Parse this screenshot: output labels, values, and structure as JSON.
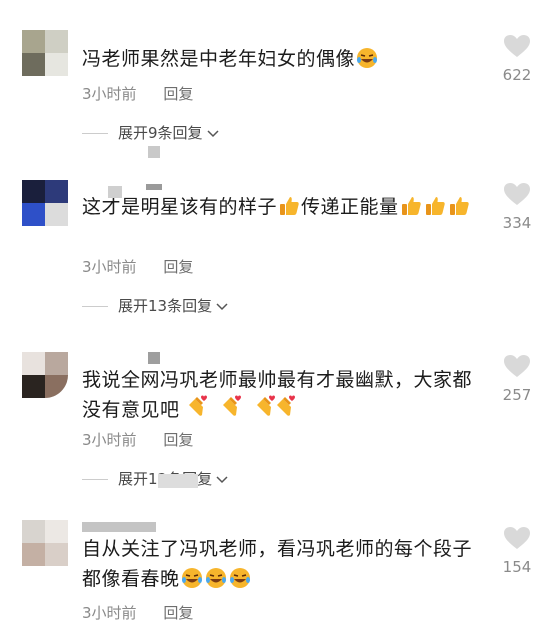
{
  "comments": [
    {
      "text_parts": [
        "冯老师果然是中老年妇女的偶像"
      ],
      "emojis": [
        "laugh"
      ],
      "time": "3小时前",
      "reply": "回复",
      "expand": "展开9条回复",
      "likes": "622"
    },
    {
      "text_part1": "这才是明星该有的样子",
      "text_part2": "传递正能量",
      "time": "3小时前",
      "reply": "回复",
      "expand": "展开13条回复",
      "likes": "334"
    },
    {
      "text": "我说全网冯巩老师最帅最有才最幽默，大家都没有意见吧",
      "time": "3小时前",
      "reply": "回复",
      "expand": "展开12条回复",
      "likes": "257"
    },
    {
      "text": "自从关注了冯巩老师，看冯巩老师的每个段子都像看春晚",
      "time": "3小时前",
      "reply": "回复",
      "likes": "154"
    }
  ],
  "icons": {
    "like": "heart-icon",
    "expand": "chevron-down-icon",
    "thumbs": "thumbs-up-emoji",
    "laugh": "laughing-tears-emoji",
    "finger_heart": "finger-heart-emoji"
  },
  "colors": {
    "text": "#1c1c1c",
    "meta": "#8a8a8a",
    "heart": "#d9d9d9",
    "emoji_yellow": "#f7b52c"
  }
}
